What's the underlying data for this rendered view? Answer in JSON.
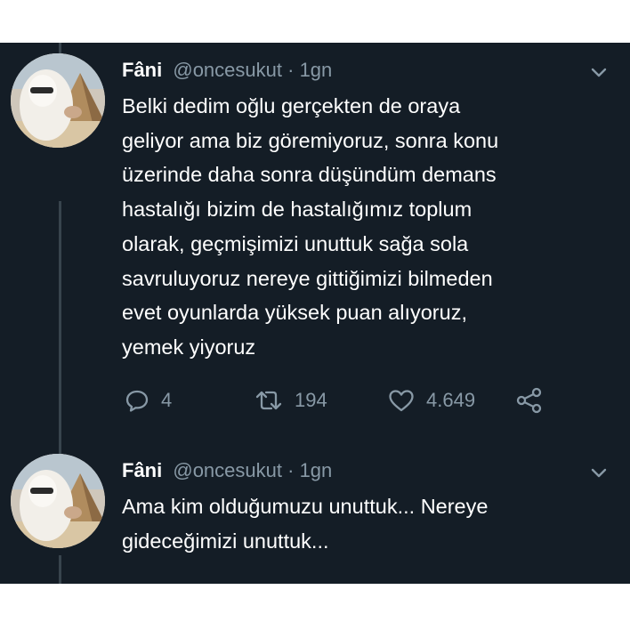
{
  "tweets": [
    {
      "author_name": "Fâni",
      "handle": "@oncesukut",
      "separator": "·",
      "time": "1gn",
      "lines": [
        "Belki dedim oğlu gerçekten de oraya",
        "geliyor ama biz göremiyoruz, sonra konu",
        "üzerinde daha sonra düşündüm demans",
        "hastalığı bizim de hastalığımız toplum",
        "olarak, geçmişimizi unuttuk sağa sola",
        "savruluyoruz nereye gittiğimizi bilmeden",
        "evet oyunlarda yüksek puan alıyoruz,",
        "yemek yiyoruz"
      ],
      "reply_count": "4",
      "retweet_count": "194",
      "like_count": "4.649"
    },
    {
      "author_name": "Fâni",
      "handle": "@oncesukut",
      "separator": "·",
      "time": "1gn",
      "lines": [
        "Ama kim olduğumuzu unuttuk... Nereye",
        "gideceğimizi unuttuk..."
      ]
    }
  ],
  "icons": {
    "reply": "reply-icon",
    "retweet": "retweet-icon",
    "like": "heart-icon",
    "share": "share-icon",
    "caret": "chevron-down-icon"
  },
  "colors": {
    "background": "#141d26",
    "text": "#ffffff",
    "secondary_text": "#8899a6",
    "thread_line": "#38444d",
    "page_border": "#ffffff"
  }
}
